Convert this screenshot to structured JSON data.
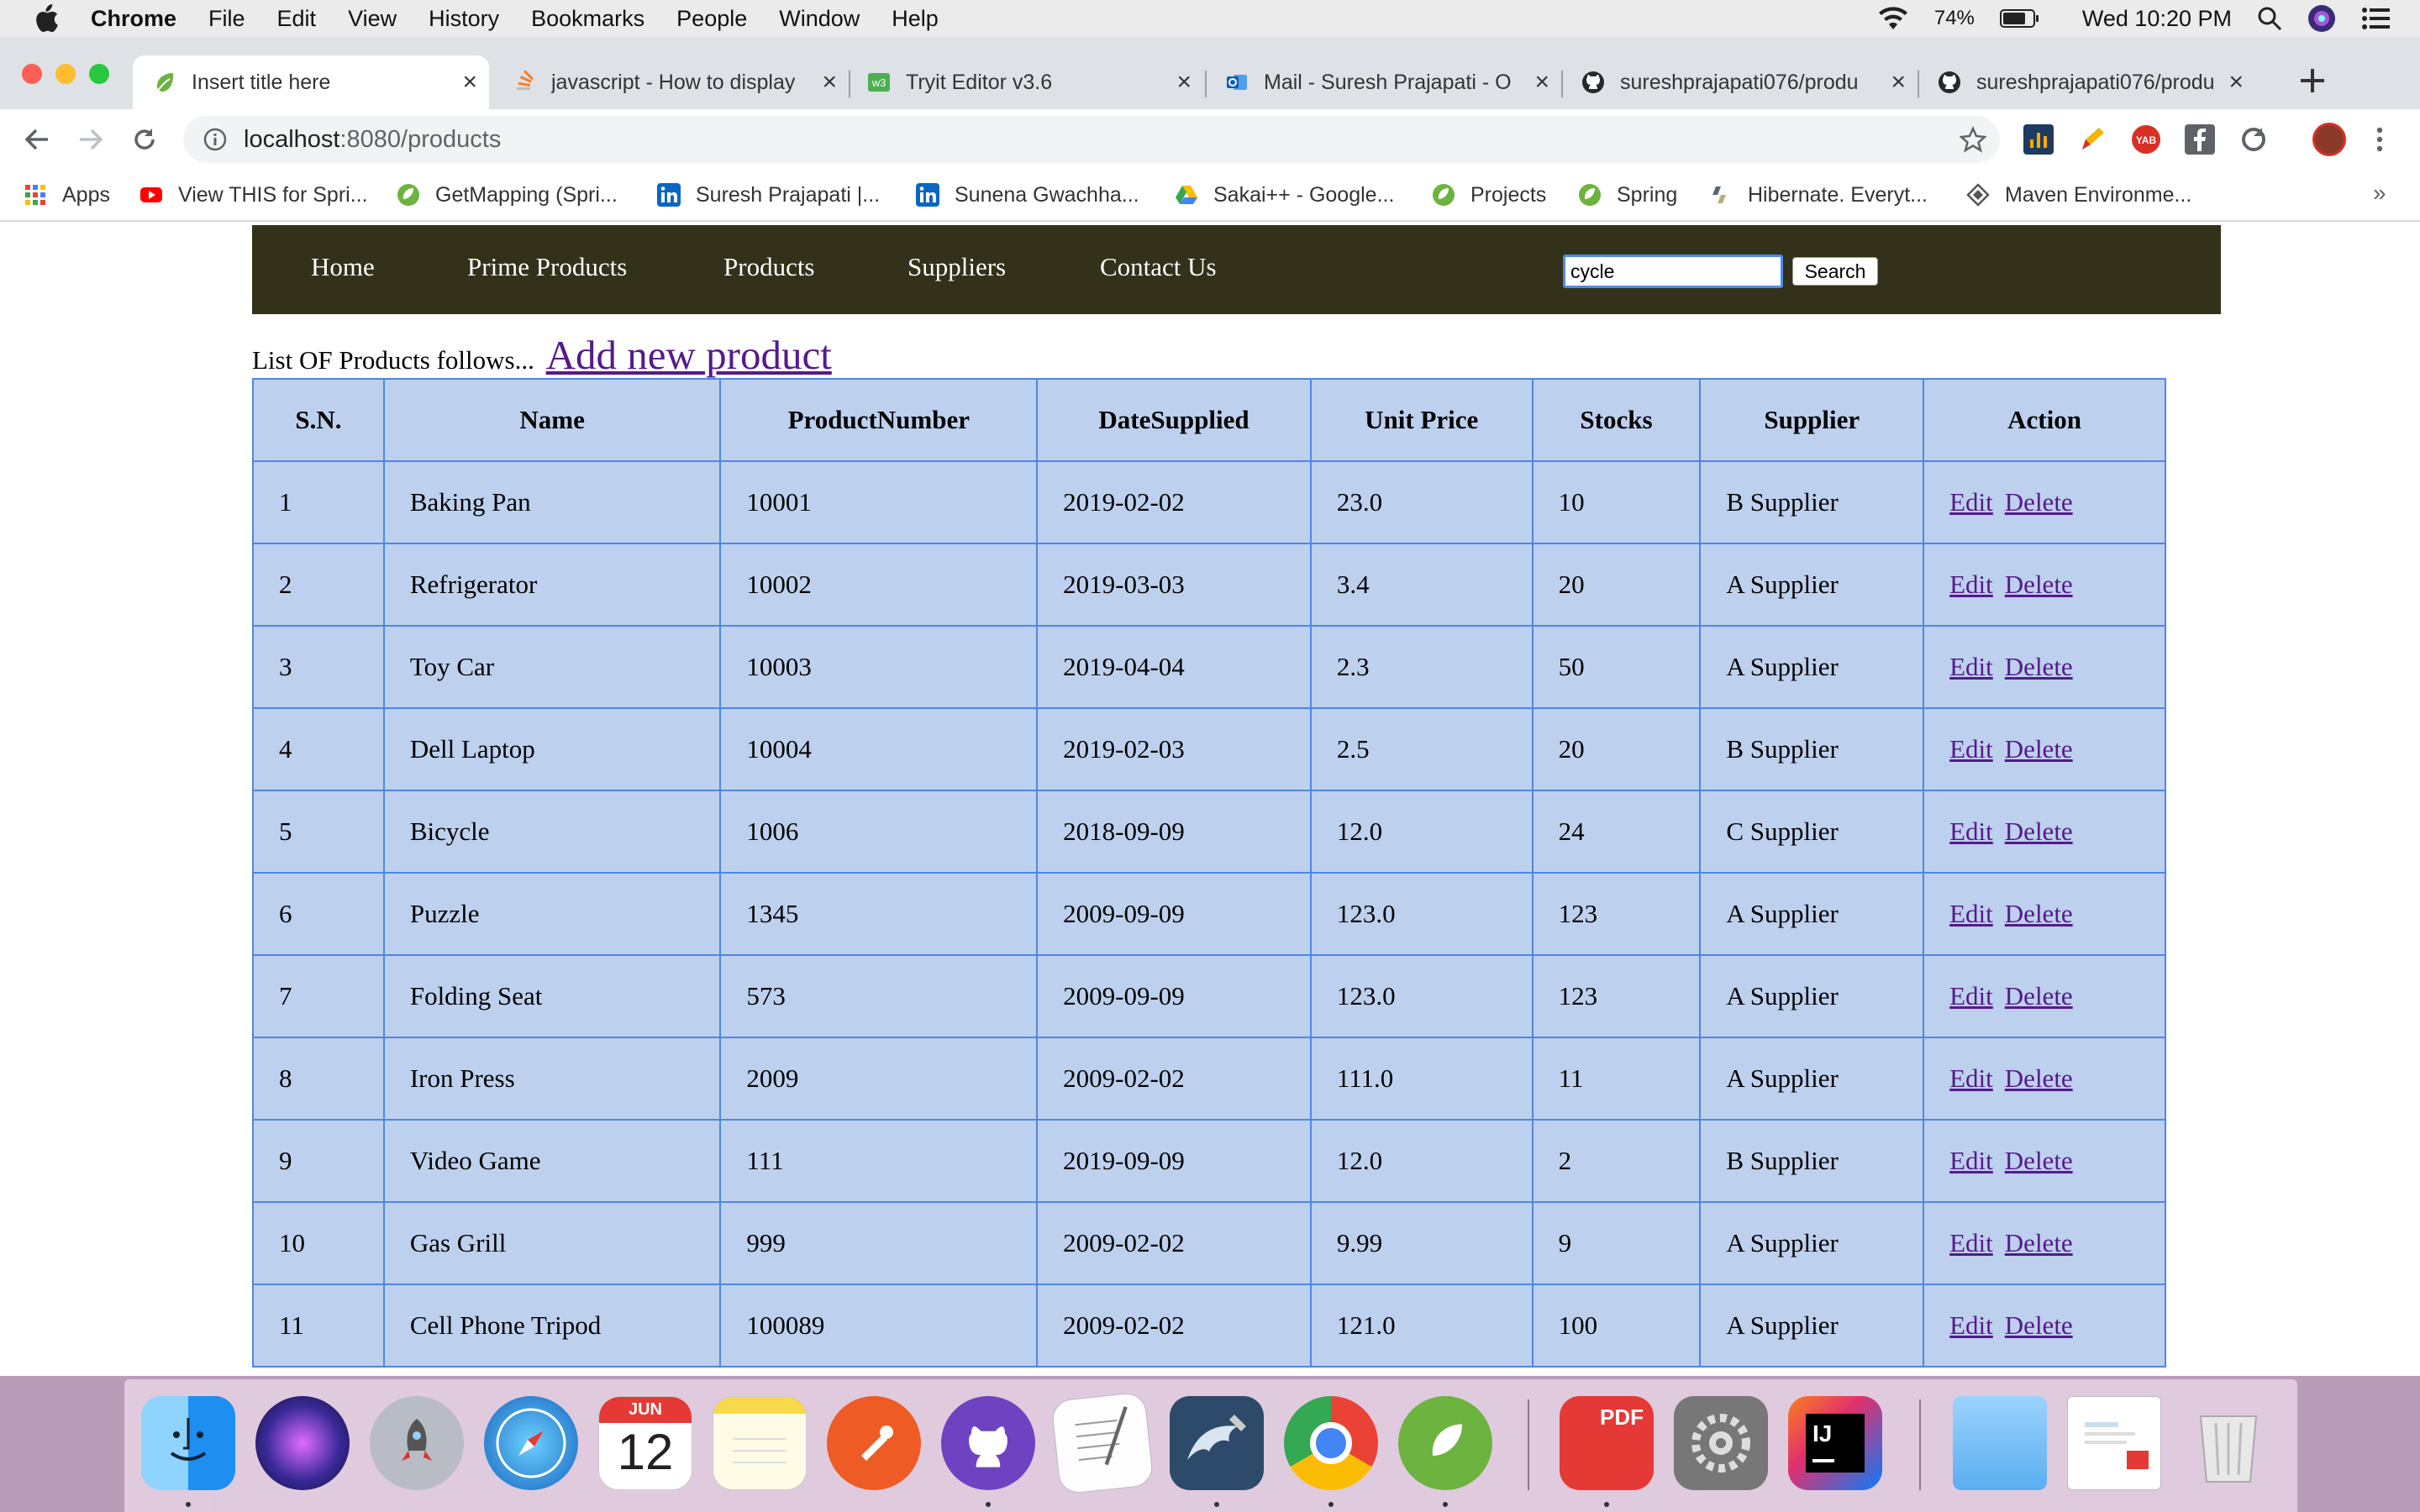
{
  "menubar": {
    "app_name": "Chrome",
    "items": [
      "File",
      "Edit",
      "View",
      "History",
      "Bookmarks",
      "People",
      "Window",
      "Help"
    ],
    "battery": "74%",
    "clock": "Wed 10:20 PM"
  },
  "tabs": [
    {
      "label": "Insert title here",
      "favicon": "spring-leaf-icon",
      "active": true
    },
    {
      "label": "javascript - How to display",
      "favicon": "stackoverflow-icon"
    },
    {
      "label": "Tryit Editor v3.6",
      "favicon": "w3schools-icon"
    },
    {
      "label": "Mail - Suresh Prajapati - O",
      "favicon": "outlook-icon"
    },
    {
      "label": "sureshprajapati076/produ",
      "favicon": "github-icon"
    },
    {
      "label": "sureshprajapati076/produ",
      "favicon": "github-icon"
    }
  ],
  "address": {
    "host": "localhost",
    "path": ":8080/products"
  },
  "bookmarks": [
    {
      "label": "Apps",
      "icon": "apps-grid-icon"
    },
    {
      "label": "View THIS for Spri...",
      "icon": "youtube-icon"
    },
    {
      "label": "GetMapping (Spri...",
      "icon": "spring-leaf-icon"
    },
    {
      "label": "Suresh Prajapati |...",
      "icon": "linkedin-icon"
    },
    {
      "label": "Sunena Gwachha...",
      "icon": "linkedin-icon"
    },
    {
      "label": "Sakai++ - Google...",
      "icon": "google-drive-icon"
    },
    {
      "label": "Projects",
      "icon": "spring-leaf-icon"
    },
    {
      "label": "Spring",
      "icon": "spring-leaf-icon"
    },
    {
      "label": "Hibernate. Everyt...",
      "icon": "hibernate-icon"
    },
    {
      "label": "Maven Environme...",
      "icon": "maven-icon"
    }
  ],
  "nav": {
    "links": [
      "Home",
      "Prime Products",
      "Products",
      "Suppliers",
      "Contact Us"
    ],
    "search_value": "cycle",
    "search_button": "Search"
  },
  "intro": {
    "text": "List OF Products follows...",
    "add_link": "Add new product"
  },
  "table": {
    "headers": [
      "S.N.",
      "Name",
      "ProductNumber",
      "DateSupplied",
      "Unit Price",
      "Stocks",
      "Supplier",
      "Action"
    ],
    "edit_label": "Edit",
    "delete_label": "Delete",
    "rows": [
      [
        "1",
        "Baking Pan",
        "10001",
        "2019-02-02",
        "23.0",
        "10",
        "B Supplier"
      ],
      [
        "2",
        "Refrigerator",
        "10002",
        "2019-03-03",
        "3.4",
        "20",
        "A Supplier"
      ],
      [
        "3",
        "Toy Car",
        "10003",
        "2019-04-04",
        "2.3",
        "50",
        "A Supplier"
      ],
      [
        "4",
        "Dell Laptop",
        "10004",
        "2019-02-03",
        "2.5",
        "20",
        "B Supplier"
      ],
      [
        "5",
        "Bicycle",
        "1006",
        "2018-09-09",
        "12.0",
        "24",
        "C Supplier"
      ],
      [
        "6",
        "Puzzle",
        "1345",
        "2009-09-09",
        "123.0",
        "123",
        "A Supplier"
      ],
      [
        "7",
        "Folding Seat",
        "573",
        "2009-09-09",
        "123.0",
        "123",
        "A Supplier"
      ],
      [
        "8",
        "Iron Press",
        "2009",
        "2009-02-02",
        "111.0",
        "11",
        "A Supplier"
      ],
      [
        "9",
        "Video Game",
        "111",
        "2019-09-09",
        "12.0",
        "2",
        "B Supplier"
      ],
      [
        "10",
        "Gas Grill",
        "999",
        "2009-02-02",
        "9.99",
        "9",
        "A Supplier"
      ],
      [
        "11",
        "Cell Phone Tripod",
        "100089",
        "2009-02-02",
        "121.0",
        "100",
        "A Supplier"
      ]
    ]
  },
  "dock": {
    "calendar_month": "JUN",
    "calendar_day": "12",
    "pdf_label": "PDF",
    "ij_label": "IJ",
    "apps": [
      "finder-icon",
      "siri-icon",
      "launchpad-icon",
      "safari-icon",
      "calendar-icon",
      "notes-icon",
      "postman-icon",
      "github-desktop-icon",
      "textedit-icon",
      "mysql-workbench-icon",
      "chrome-icon",
      "spring-tool-suite-icon",
      "pdf-expert-icon",
      "system-preferences-icon",
      "intellij-icon",
      "downloads-folder-icon",
      "document-stack-icon",
      "trash-icon"
    ]
  }
}
